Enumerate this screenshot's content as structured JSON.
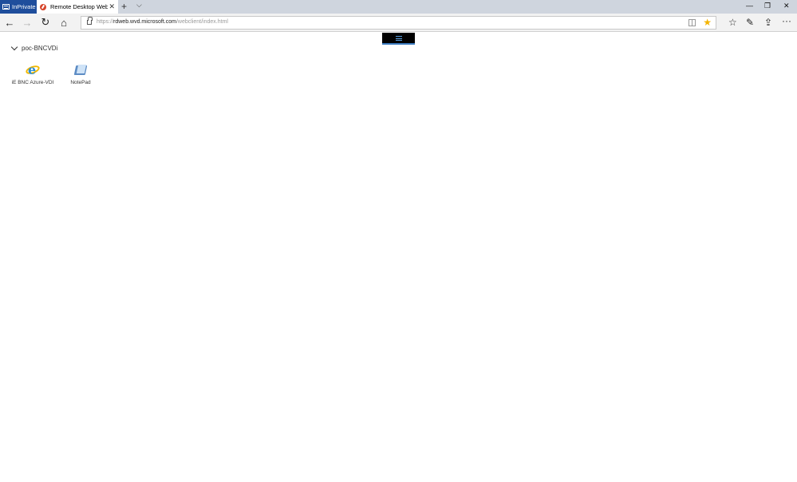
{
  "browser": {
    "inprivate_label": "InPrivate",
    "tab_title": "Remote Desktop Web C",
    "tab_close": "✕",
    "new_tab": "+",
    "tab_menu": "⌵",
    "window": {
      "minimize": "—",
      "restore": "❐",
      "close": "✕"
    },
    "url_prefix": "https://",
    "url_host": "rdweb.wvd.microsoft.com",
    "url_path": "/webclient/index.html",
    "nav": {
      "back": "←",
      "forward": "→",
      "refresh": "↻",
      "home": "⌂"
    },
    "toolbar": {
      "favorites": "☆",
      "notes": "✎",
      "share": "⇪",
      "more": "···",
      "star": "★"
    }
  },
  "workspace": {
    "group_name": "poc-BNCVDi",
    "apps": [
      {
        "label": "iE BNC Azure-VDI",
        "icon": "internet-explorer-icon"
      },
      {
        "label": "NotePad",
        "icon": "notepad-icon"
      }
    ]
  },
  "colors": {
    "inprivate": "#1f4e9c",
    "titlebar": "#cfd5de",
    "accent": "#3b7bbf",
    "star": "#f4b400"
  }
}
